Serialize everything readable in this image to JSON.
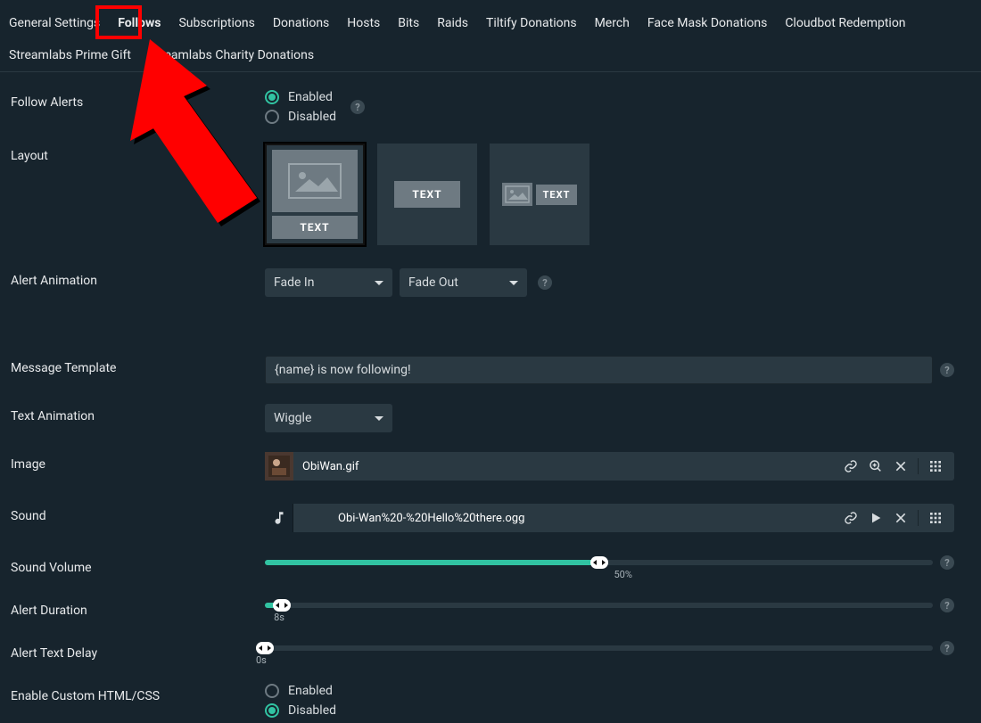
{
  "tabs": [
    "General Settings",
    "Follows",
    "Subscriptions",
    "Donations",
    "Hosts",
    "Bits",
    "Raids",
    "Tiltify Donations",
    "Merch",
    "Face Mask Donations",
    "Cloudbot Redemption",
    "Streamlabs Prime Gift",
    "Streamlabs Charity Donations"
  ],
  "activeTab": 1,
  "labels": {
    "followAlerts": "Follow Alerts",
    "layout": "Layout",
    "alertAnimation": "Alert Animation",
    "messageTemplate": "Message Template",
    "textAnimation": "Text Animation",
    "image": "Image",
    "sound": "Sound",
    "soundVolume": "Sound Volume",
    "alertDuration": "Alert Duration",
    "alertTextDelay": "Alert Text Delay",
    "enableCustom": "Enable Custom HTML/CSS"
  },
  "radio": {
    "enabled": "Enabled",
    "disabled": "Disabled"
  },
  "layoutText": "TEXT",
  "alertAnimation": {
    "in": "Fade In",
    "out": "Fade Out"
  },
  "messageTemplate": "{name} is now following!",
  "textAnimation": "Wiggle",
  "imageFile": "ObiWan.gif",
  "soundFile": "Obi-Wan%20-%20Hello%20there.ogg",
  "sliders": {
    "volume": {
      "pct": 50,
      "label": "50%"
    },
    "duration": {
      "pct": 2.5,
      "label": "8s"
    },
    "delay": {
      "pct": 0,
      "label": "0s"
    }
  },
  "followAlertsEnabled": true,
  "customEnabled": false
}
